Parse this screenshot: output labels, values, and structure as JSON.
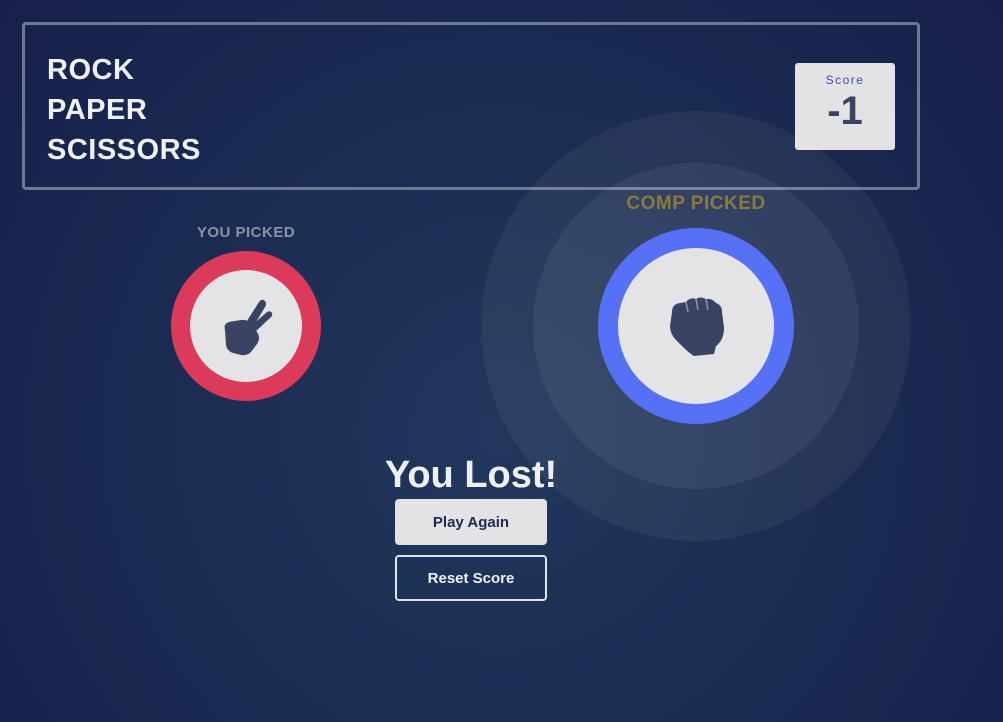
{
  "header": {
    "title_lines": [
      "ROCK",
      "PAPER",
      "SCISSORS"
    ],
    "score_label": "Score",
    "score_value": "-1"
  },
  "player": {
    "label": "YOU PICKED",
    "choice_icon": "scissors-hand-icon",
    "ring_color": "#dc3a5a"
  },
  "computer": {
    "label": "COMP PICKED",
    "choice_icon": "rock-fist-icon",
    "ring_color": "#5671f5"
  },
  "result": {
    "text": "You Lost!"
  },
  "buttons": {
    "play_again": "Play Again",
    "reset_score": "Reset Score"
  }
}
